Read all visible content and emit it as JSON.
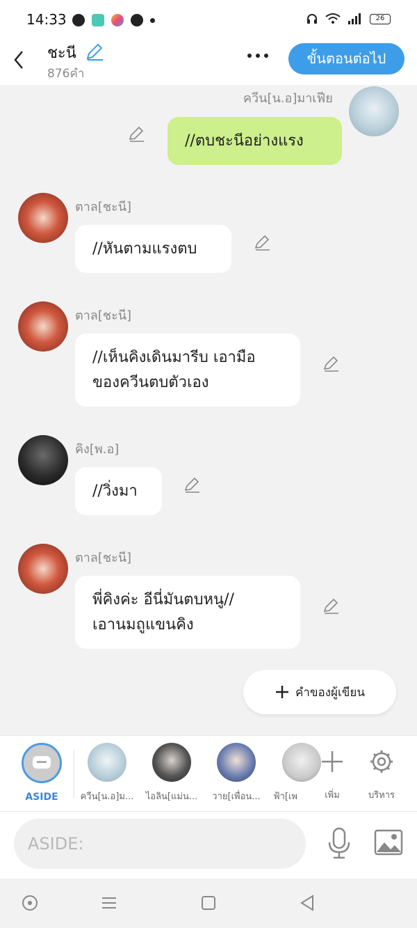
{
  "status": {
    "time": "14:33",
    "battery": "26"
  },
  "header": {
    "title": "ชะนี",
    "word_count": "876คำ",
    "next_label": "ขั้นตอนต่อไป"
  },
  "messages": [
    {
      "name": "ควีน[น.อ]มาเฟีย",
      "text": "//ตบชะนีอย่างแรง",
      "mine": true
    },
    {
      "name": "ตาล[ชะนี]",
      "text": "//หันตามแรงตบ"
    },
    {
      "name": "ตาล[ชะนี]",
      "line1": "//เห็นคิงเดินมารีบ เอามือ",
      "line2": "ของควีนตบตัวเอง"
    },
    {
      "name": "คิง[พ.อ]",
      "text": "//วิ่งมา"
    },
    {
      "name": "ตาล[ชะนี]",
      "line1": "พี่คิงค่ะ  อีนี่มันตบหนู//",
      "line2": "เอานมถูแขนคิง"
    }
  ],
  "author_words_label": "คำของผู้เขียน",
  "characters": {
    "aside_label": "ASIDE",
    "items": [
      "ควีน[น.อ]ม...",
      "ไอลิน[แม่น...",
      "วาย[เพื่อน...",
      "ฟ้า[เพ"
    ],
    "add_label": "เพิ่ม",
    "manage_label": "บริหาร"
  },
  "input": {
    "placeholder": "ASIDE:"
  },
  "colors": {
    "accent": "#3d9de8",
    "mine_bubble": "#cdef8c"
  }
}
